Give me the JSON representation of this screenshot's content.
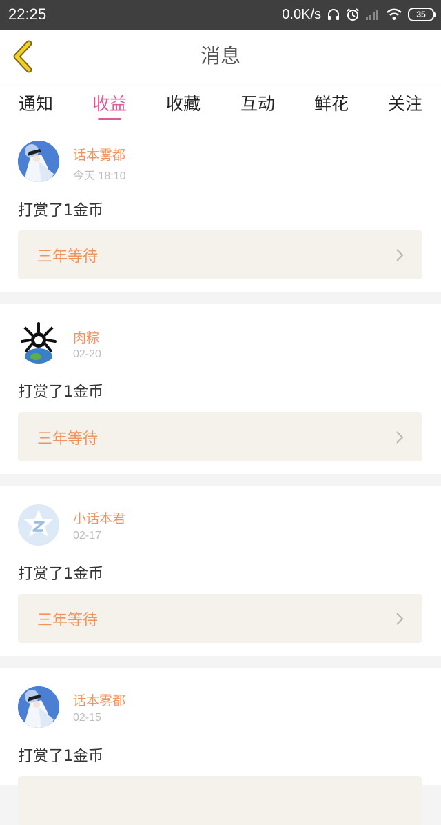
{
  "status_bar": {
    "time": "22:25",
    "net_speed": "0.0K/s",
    "battery": "35",
    "icons": [
      "headphones-icon",
      "alarm-icon",
      "signal-icon",
      "wifi-icon",
      "battery-icon"
    ]
  },
  "header": {
    "title": "消息",
    "back_icon": "chevron-left-icon"
  },
  "tabs": [
    {
      "label": "通知",
      "active": false
    },
    {
      "label": "收益",
      "active": true
    },
    {
      "label": "收藏",
      "active": false
    },
    {
      "label": "互动",
      "active": false
    },
    {
      "label": "鲜花",
      "active": false
    },
    {
      "label": "关注",
      "active": false
    }
  ],
  "messages": [
    {
      "user": "话本雾都",
      "time": "今天 18:10",
      "text": "打赏了1金币",
      "book": "三年等待",
      "avatar": "anime-avatar"
    },
    {
      "user": "肉粽",
      "time": "02-20",
      "text": "打赏了1金币",
      "book": "三年等待",
      "avatar": "zongzi-avatar"
    },
    {
      "user": "小话本君",
      "time": "02-17",
      "text": "打赏了1金币",
      "book": "三年等待",
      "avatar": "default-avatar"
    },
    {
      "user": "话本雾都",
      "time": "02-15",
      "text": "打赏了1金币",
      "book": "",
      "avatar": "anime-avatar"
    }
  ],
  "colors": {
    "accent": "#e05a9a",
    "username": "#f2935d",
    "book_bg": "#f4f2ea",
    "status_bar": "#3f3f3f"
  }
}
